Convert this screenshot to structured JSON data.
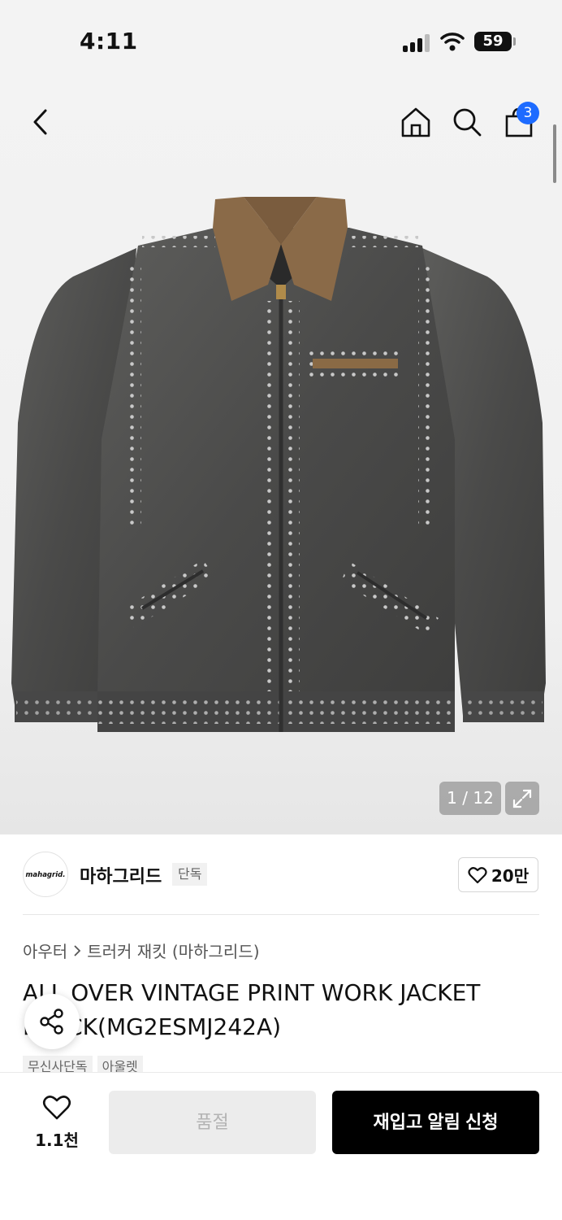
{
  "status_bar": {
    "time": "4:11",
    "battery": "59"
  },
  "nav": {
    "cart_count": "3"
  },
  "gallery": {
    "pager": "1 / 12"
  },
  "brand": {
    "logo_text": "mahagrid.",
    "name": "마하그리드",
    "badge": "단독",
    "likes": "20만"
  },
  "breadcrumb": {
    "category": "아우터",
    "subcategory": "트러커 재킷 (마하그리드)"
  },
  "product": {
    "title": "ALL OVER VINTAGE PRINT WORK JACKET BLACK(MG2ESMJ242A)",
    "tags": [
      "무신사단독",
      "아울렛"
    ]
  },
  "bottom": {
    "wish_count": "1.1천",
    "soldout_label": "품절",
    "restock_label": "재입고 알림 신청"
  },
  "colors": {
    "badge_blue": "#1d6bff",
    "primary_button": "#000000",
    "disabled_button": "#ececec"
  }
}
